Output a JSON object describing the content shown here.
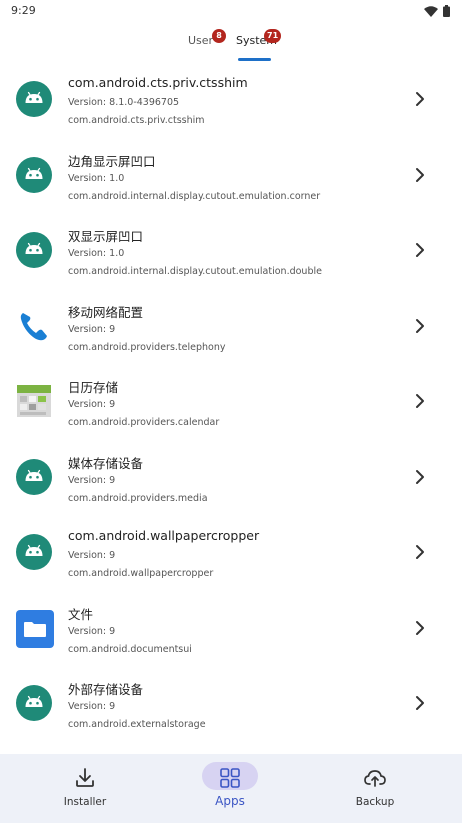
{
  "status_bar": {
    "time": "9:29"
  },
  "tabs": [
    {
      "label": "User",
      "count": "8",
      "selected": false
    },
    {
      "label": "System",
      "count": "71",
      "selected": true
    }
  ],
  "apps": [
    {
      "name": "com.android.cts.priv.ctsshim",
      "version": "Version: 8.1.0-4396705",
      "package": "com.android.cts.priv.ctsshim",
      "icon": "android-icon"
    },
    {
      "name": "边角显示屏凹口",
      "version": "Version: 1.0",
      "package": "com.android.internal.display.cutout.emulation.corner",
      "icon": "android-icon"
    },
    {
      "name": "双显示屏凹口",
      "version": "Version: 1.0",
      "package": "com.android.internal.display.cutout.emulation.double",
      "icon": "android-icon"
    },
    {
      "name": "移动网络配置",
      "version": "Version: 9",
      "package": "com.android.providers.telephony",
      "icon": "phone-icon"
    },
    {
      "name": "日历存储",
      "version": "Version: 9",
      "package": "com.android.providers.calendar",
      "icon": "calendar-storage-icon"
    },
    {
      "name": "媒体存储设备",
      "version": "Version: 9",
      "package": "com.android.providers.media",
      "icon": "android-icon"
    },
    {
      "name": "com.android.wallpapercropper",
      "version": "Version: 9",
      "package": "com.android.wallpapercropper",
      "icon": "android-icon"
    },
    {
      "name": "文件",
      "version": "Version: 9",
      "package": "com.android.documentsui",
      "icon": "folder-icon"
    },
    {
      "name": "外部存储设备",
      "version": "Version: 9",
      "package": "com.android.externalstorage",
      "icon": "android-icon"
    }
  ],
  "bottom_nav": {
    "installer": "Installer",
    "apps": "Apps",
    "backup": "Backup"
  },
  "colors": {
    "accent": "#1e70c8",
    "badge": "#b3261e",
    "android_teal": "#1f8a78",
    "nav_background": "#eef1f8",
    "nav_active_pill": "#d7d3f2"
  }
}
